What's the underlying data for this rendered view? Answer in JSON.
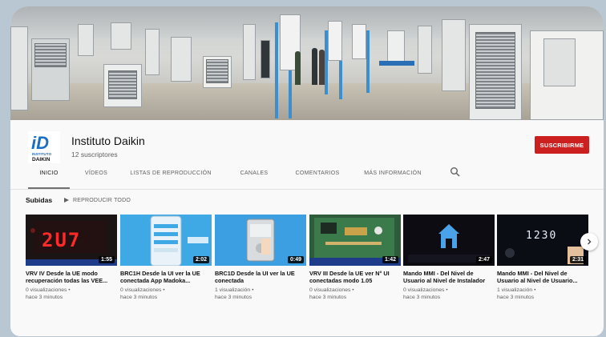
{
  "channel": {
    "name": "Instituto Daikin",
    "subscribers": "12 suscriptores",
    "subscribe_label": "SUSCRIBIRME",
    "logo_text_line1": "INSTITUTO",
    "logo_text_line2": "DAIKIN",
    "logo_mark": "iD"
  },
  "tabs": [
    {
      "label": "INICIO",
      "active": true
    },
    {
      "label": "VÍDEOS"
    },
    {
      "label": "LISTAS DE REPRODUCCIÓN"
    },
    {
      "label": "CANALES"
    },
    {
      "label": "COMENTARIOS"
    },
    {
      "label": "MÁS INFORMACIÓN"
    }
  ],
  "section": {
    "title": "Subidas",
    "play_all_label": "REPRODUCIR TODO"
  },
  "videos": [
    {
      "title": "VRV IV Desde la UE modo recuperación todas las VEE...",
      "duration": "1:55",
      "views": "0 visualizaciones •",
      "age": "hace 3 minutos",
      "screen_text": "2U7"
    },
    {
      "title": "BRC1H Desde la UI ver la UE conectada App Madoka...",
      "duration": "2:02",
      "views": "0 visualizaciones •",
      "age": "hace 3 minutos"
    },
    {
      "title": "BRC1D Desde la UI ver la UE conectada",
      "duration": "0:49",
      "views": "1 visualización •",
      "age": "hace 3 minutos"
    },
    {
      "title": "VRV III Desde la UE ver N° UI conectadas modo 1.05",
      "duration": "1:42",
      "views": "0 visualizaciones •",
      "age": "hace 3 minutos"
    },
    {
      "title": "Mando MMI - Del Nivel de Usuario al Nivel de Instalador",
      "duration": "2:47",
      "views": "0 visualizaciones •",
      "age": "hace 3 minutos"
    },
    {
      "title": "Mando MMI - Del Nivel de Usuario al Nivel de Usuario...",
      "duration": "2:31",
      "views": "1 visualización •",
      "age": "hace 3 minutos",
      "screen_text": "1230"
    }
  ],
  "colors": {
    "subscribe": "#cc1f1f",
    "logo_blue": "#1a6fc4",
    "text_primary": "#111111",
    "text_secondary": "#606060"
  },
  "icons": {
    "search": "search-icon",
    "play": "play-icon",
    "next": "chevron-right-icon"
  }
}
